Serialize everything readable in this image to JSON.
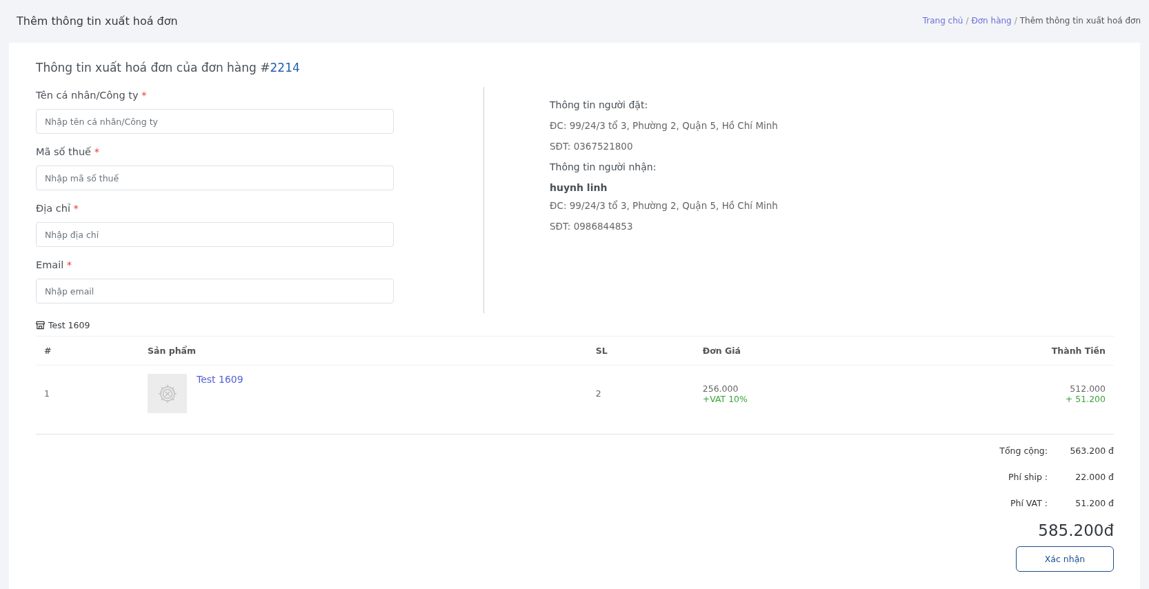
{
  "page_header": {
    "title": "Thêm thông tin xuất hoá đơn",
    "breadcrumb": [
      {
        "label": "Trang chủ",
        "kind": "link"
      },
      {
        "label": "/",
        "kind": "separator"
      },
      {
        "label": "Đơn hàng",
        "kind": "link"
      },
      {
        "label": "/",
        "kind": "separator"
      },
      {
        "label": "Thêm thông tin xuất hoá đơn",
        "kind": "current"
      }
    ]
  },
  "card": {
    "title": "Thông tin xuất hoá đơn của đơn hàng #",
    "order_number": "2214",
    "form": {
      "fields": [
        {
          "label": "Tên cá nhân/Công ty",
          "required_mark": "*",
          "placeholder": "Nhập tên cá nhân/Công ty"
        },
        {
          "label": "Mã số thuế",
          "required_mark": "*",
          "placeholder": "Nhập mã số thuế"
        },
        {
          "label": "Địa chỉ",
          "required_mark": "*",
          "placeholder": "Nhập địa chỉ"
        },
        {
          "label": "Email",
          "required_mark": "*",
          "placeholder": "Nhập email"
        }
      ]
    },
    "customer_info": [
      {
        "kind": "heading",
        "text": "Thông tin người đặt:"
      },
      {
        "kind": "line",
        "text": "ĐC: 99/24/3 tổ 3, Phường 2, Quận 5, Hồ Chí Minh"
      },
      {
        "kind": "line",
        "text": "SĐT: 0367521800"
      },
      {
        "kind": "heading",
        "text": "Thông tin người nhận:"
      },
      {
        "kind": "name",
        "text": "huynh linh"
      },
      {
        "kind": "line",
        "text": "ĐC: 99/24/3 tổ 3, Phường 2, Quận 5, Hồ Chí Minh"
      },
      {
        "kind": "line",
        "text": "SĐT: 0986844853"
      }
    ],
    "store": {
      "name": "Test 1609"
    },
    "table": {
      "columns": [
        "#",
        "Sản phẩm",
        "SL",
        "Đơn Giá",
        "Thành Tiền"
      ],
      "rows": [
        {
          "index": "1",
          "product": "Test 1609",
          "quantity": "2",
          "unit_price": "256.000",
          "unit_vat": "+VAT 10%",
          "total": "512.000",
          "total_vat": "+ 51.200"
        }
      ]
    },
    "summary": [
      {
        "label": "Tổng cộng:",
        "value": "563.200 đ"
      },
      {
        "label": "Phí ship :",
        "value": "22.000 đ"
      },
      {
        "label": "Phí VAT :",
        "value": "51.200 đ"
      }
    ],
    "grand_total": "585.200đ",
    "buttons": [
      "Xác nhận"
    ]
  }
}
